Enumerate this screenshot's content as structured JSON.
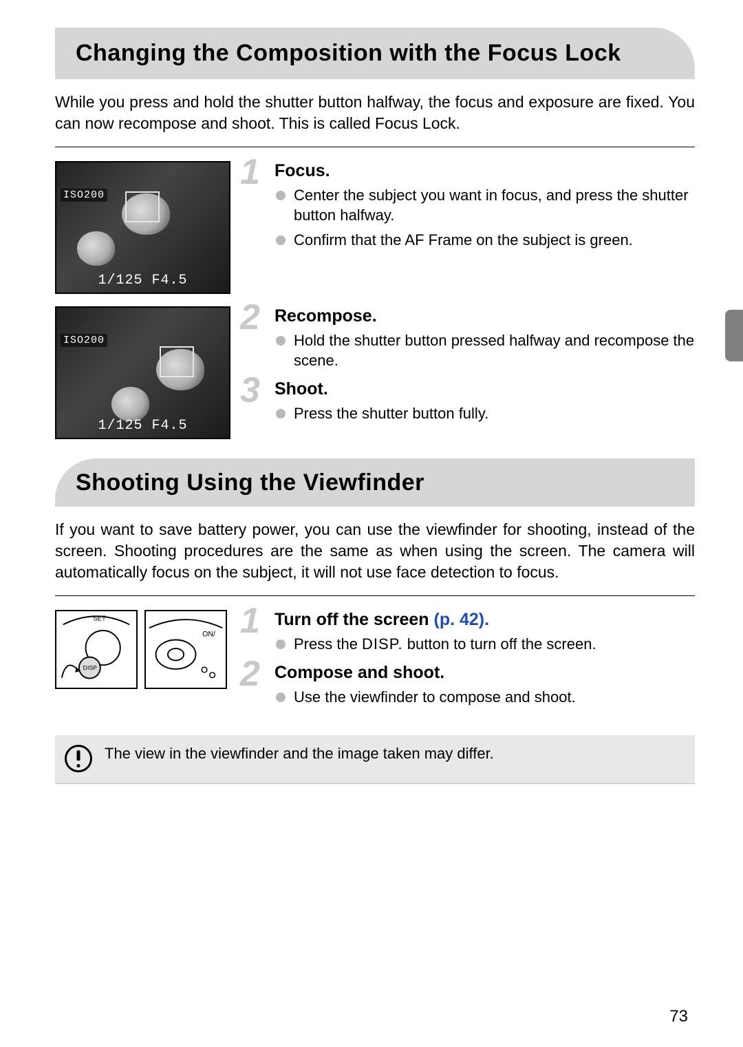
{
  "pageNumber": "73",
  "section1": {
    "heading": "Changing the Composition with the Focus Lock",
    "intro": "While you press and hold the shutter button halfway, the focus and exposure are fixed. You can now recompose and shoot. This is called Focus Lock.",
    "thumbs": {
      "iso": "ISO200",
      "readout": "1/125  F4.5"
    },
    "steps": [
      {
        "num": "1",
        "title": "Focus.",
        "bullets": [
          "Center the subject you want in focus, and press the shutter button halfway.",
          "Confirm that the AF Frame on the subject is green."
        ]
      },
      {
        "num": "2",
        "title": "Recompose.",
        "bullets": [
          "Hold the shutter button pressed halfway and recompose the scene."
        ]
      },
      {
        "num": "3",
        "title": "Shoot.",
        "bullets": [
          "Press the shutter button fully."
        ]
      }
    ]
  },
  "section2": {
    "heading": "Shooting Using the Viewfinder",
    "intro": "If you want to save battery power, you can use the viewfinder for shooting, instead of the screen. Shooting procedures are the same as when using the screen. The camera will automatically focus on the subject, it will not use face detection to focus.",
    "dispLabel": "DISP.",
    "steps": [
      {
        "num": "1",
        "title_pre": "Turn off the screen ",
        "title_ref": "(p. 42).",
        "bullets_pre": [
          "Press the "
        ],
        "bullets_post": [
          " button to turn off the screen."
        ]
      },
      {
        "num": "2",
        "title": "Compose and shoot.",
        "bullets": [
          "Use the viewfinder to compose and shoot."
        ]
      }
    ],
    "note": "The view in the viewfinder and the image taken may differ."
  },
  "diagramLabels": {
    "set": "SET",
    "on": "ON/"
  }
}
